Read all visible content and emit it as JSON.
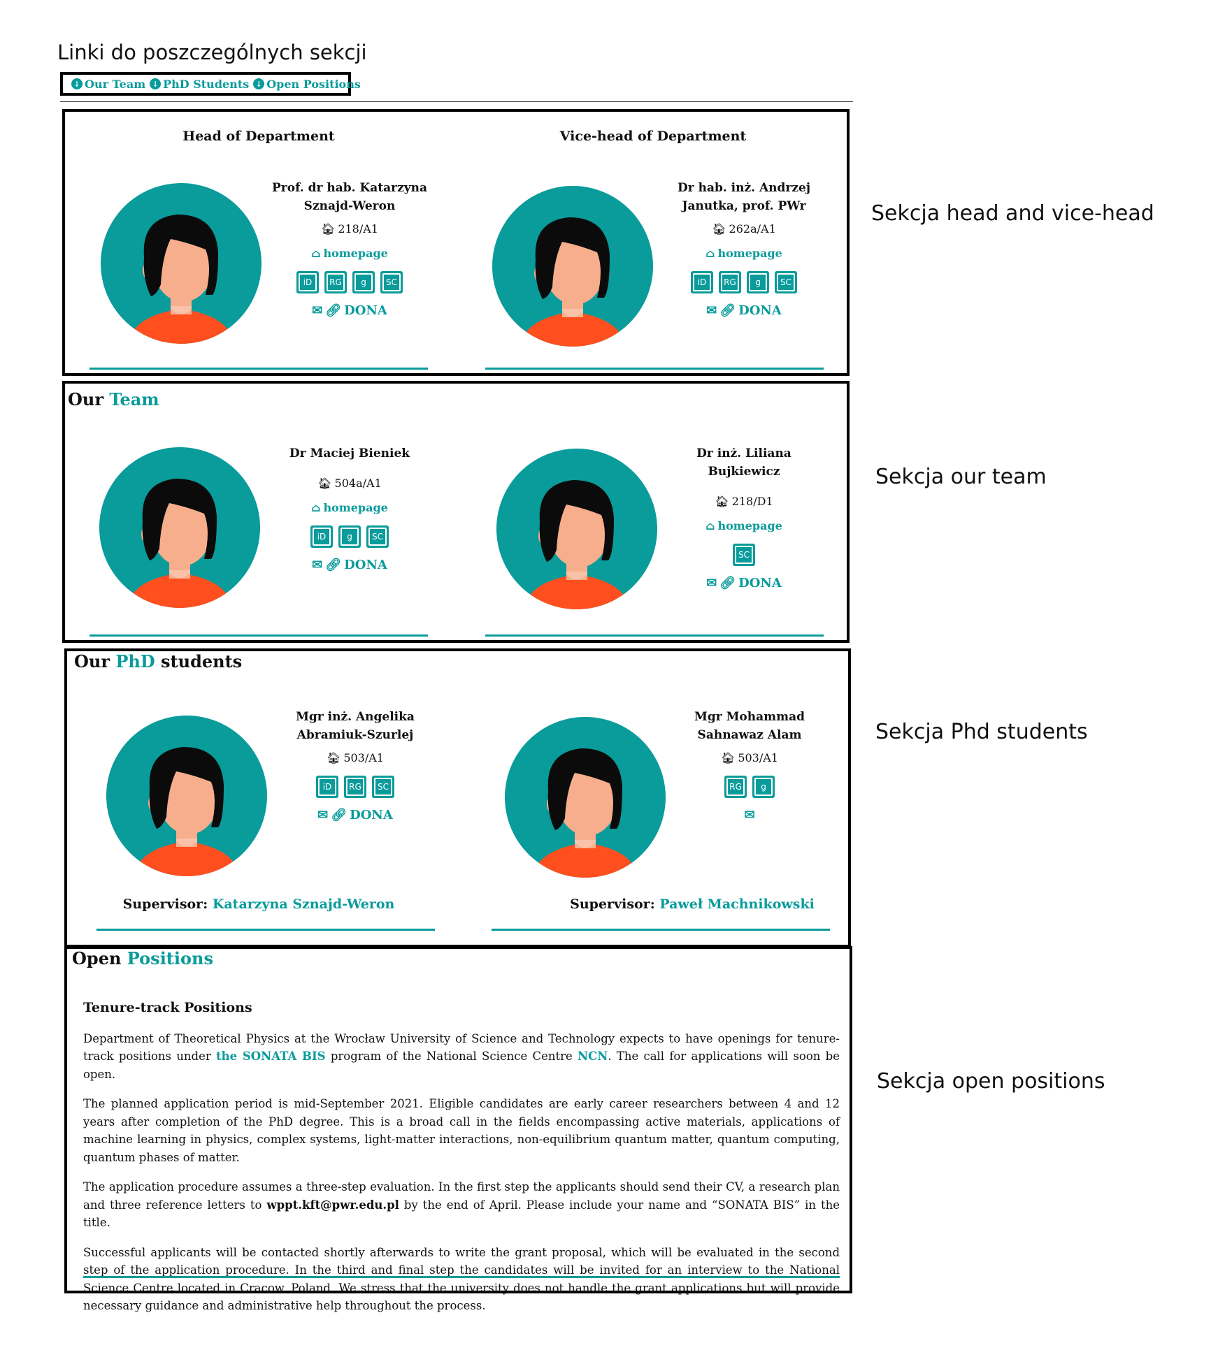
{
  "annotations": {
    "title": "Linki do poszczególnych sekcji",
    "head": "Sekcja head and vice-head",
    "team": "Sekcja our team",
    "phd": "Sekcja Phd students",
    "open": "Sekcja open positions"
  },
  "nav": [
    {
      "label": "Our Team"
    },
    {
      "label": "PhD Students"
    },
    {
      "label": "Open Positions"
    }
  ],
  "heads": {
    "left": {
      "role": "Head of Department",
      "name1": "Prof. dr hab. Katarzyna",
      "name2": "Sznajd-Weron",
      "room": "218/A1",
      "homepage": "homepage",
      "icons": [
        "iD",
        "RG",
        "g",
        "SC"
      ],
      "dona": "DONA"
    },
    "right": {
      "role": "Vice-head of Department",
      "name1": "Dr hab. inż. Andrzej",
      "name2": "Janutka, prof. PWr",
      "room": "262a/A1",
      "homepage": "homepage",
      "icons": [
        "iD",
        "RG",
        "g",
        "SC"
      ],
      "dona": "DONA"
    }
  },
  "team": {
    "title_a": "Our",
    "title_b": "Team",
    "left": {
      "name1": "Dr Maciej Bieniek",
      "room": "504a/A1",
      "homepage": "homepage",
      "icons": [
        "iD",
        "g",
        "SC"
      ],
      "dona": "DONA"
    },
    "right": {
      "name1": "Dr inż. Liliana Bujkiewicz",
      "room": "218/D1",
      "homepage": "homepage",
      "icons": [
        "SC"
      ],
      "dona": "DONA"
    }
  },
  "phd": {
    "title_a": "Our",
    "title_b": "PhD",
    "title_c": "students",
    "left": {
      "name1": "Mgr inż. Angelika",
      "name2": "Abramiuk-Szurlej",
      "room": "503/A1",
      "icons": [
        "iD",
        "RG",
        "SC"
      ],
      "dona": "DONA",
      "supervisor_label": "Supervisor:",
      "supervisor": "Katarzyna Sznajd-Weron"
    },
    "right": {
      "name1": "Mgr Mohammad",
      "name2": "Sahnawaz Alam",
      "room": "503/A1",
      "icons": [
        "RG",
        "g"
      ],
      "supervisor_label": "Supervisor:",
      "supervisor": "Paweł Machnikowski"
    }
  },
  "open": {
    "title_a": "Open",
    "title_b": "Positions",
    "heading": "Tenure-track Positions",
    "p1_a": "Department of Theoretical Physics at the Wrocław University of Science and Technology expects to have openings for tenure-track positions under ",
    "p1_link1": "the SONATA BIS",
    "p1_b": " program of the National Science Centre ",
    "p1_link2": "NCN",
    "p1_c": ". The call for applications will soon be open.",
    "p2": "The planned application period is mid-September 2021. Eligible candidates are early career researchers between 4 and 12 years after completion of the PhD degree. This is a broad call in the fields encompassing active materials, applications of machine learning in physics, complex systems, light-matter interactions, non-equilibrium quantum matter, quantum computing, quantum phases of matter.",
    "p3_a": "The application procedure assumes a three-step evaluation. In the first step the applicants should send their CV, a research plan and three reference letters to ",
    "p3_email": "wppt.kft@pwr.edu.pl",
    "p3_b": " by the end of April. Please include your name and “SONATA BIS” in the title.",
    "p4": "Successful applicants will be contacted shortly afterwards to write the grant proposal, which will be evaluated in the second step of the application procedure. In the third and final step the candidates will be invited for an interview to the National Science Centre located in Cracow, Poland. We stress that the university does not handle the grant applications but will provide necessary guidance and administrative help throughout the process."
  },
  "colors": {
    "accent": "#0a9b9b",
    "avatar_bg": "#0a9b9b",
    "skin": "#f7ae8c",
    "shirt": "#ff4f1f"
  }
}
